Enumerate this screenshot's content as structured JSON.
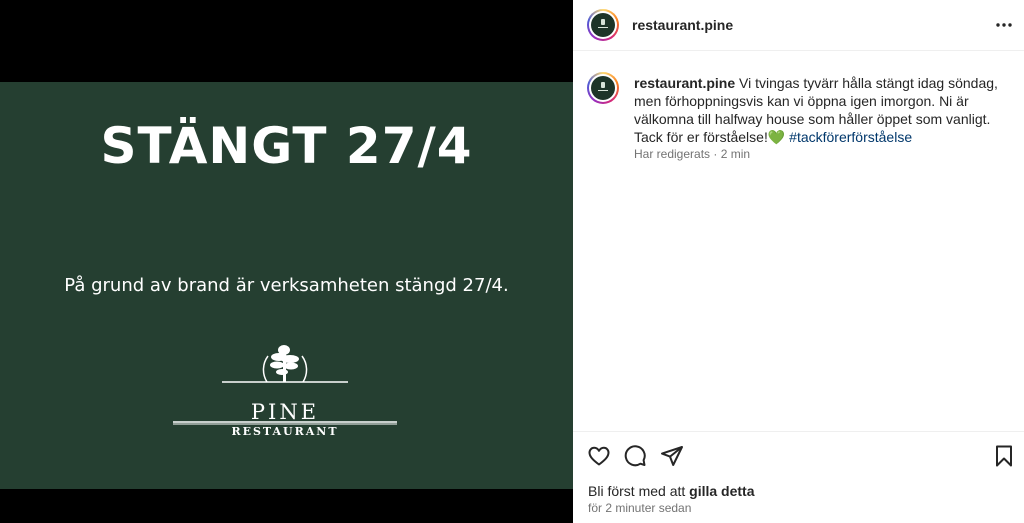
{
  "post_image": {
    "headline": "STÄNGT 27/4",
    "subtitle": "På grund av brand är verksamheten stängd 27/4.",
    "logo_name": "PINE",
    "logo_sub": "RESTAURANT"
  },
  "header": {
    "username": "restaurant.pine",
    "more_icon": "more-options-icon"
  },
  "caption": {
    "username": "restaurant.pine",
    "text": " Vi tvingas tyvärr hålla stängt idag söndag, men förhoppningsvis kan vi öppna igen imorgon. Ni är välkomna till halfway house som håller öppet som vanligt. Tack för er förståelse!💚 ",
    "hashtag": "#tackförerförståelse",
    "edited": "Har redigerats",
    "time_ago": "2 min"
  },
  "actions": {
    "icons": [
      "heart-icon",
      "comment-icon",
      "share-icon",
      "bookmark-icon"
    ],
    "likes_prefix": "Bli först med att ",
    "likes_bold": "gilla detta",
    "timestamp": "för 2 minuter sedan"
  },
  "colors": {
    "poster_bg": "#253f31",
    "hashtag": "#00376b",
    "muted": "#737373"
  }
}
